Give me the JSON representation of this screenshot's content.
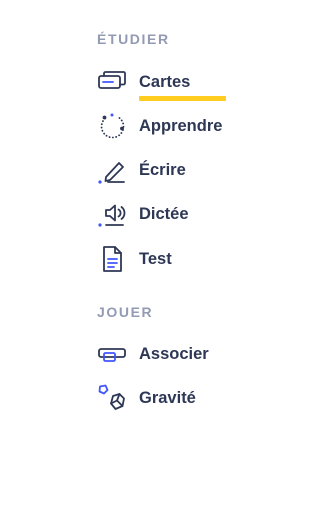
{
  "sections": {
    "study": {
      "label": "ÉTUDIER",
      "items": [
        {
          "label": "Cartes",
          "icon": "flashcards-icon",
          "active": true
        },
        {
          "label": "Apprendre",
          "icon": "learn-cycle-icon"
        },
        {
          "label": "Écrire",
          "icon": "write-pen-icon"
        },
        {
          "label": "Dictée",
          "icon": "speaker-icon"
        },
        {
          "label": "Test",
          "icon": "test-document-icon"
        }
      ]
    },
    "play": {
      "label": "JOUER",
      "items": [
        {
          "label": "Associer",
          "icon": "match-cards-icon"
        },
        {
          "label": "Gravité",
          "icon": "gravity-asteroid-icon"
        }
      ]
    }
  },
  "colors": {
    "accent_blue": "#4255ff",
    "text_dark": "#2e3856",
    "section_gray": "#939bb4",
    "active_underline": "#ffcd1f"
  }
}
